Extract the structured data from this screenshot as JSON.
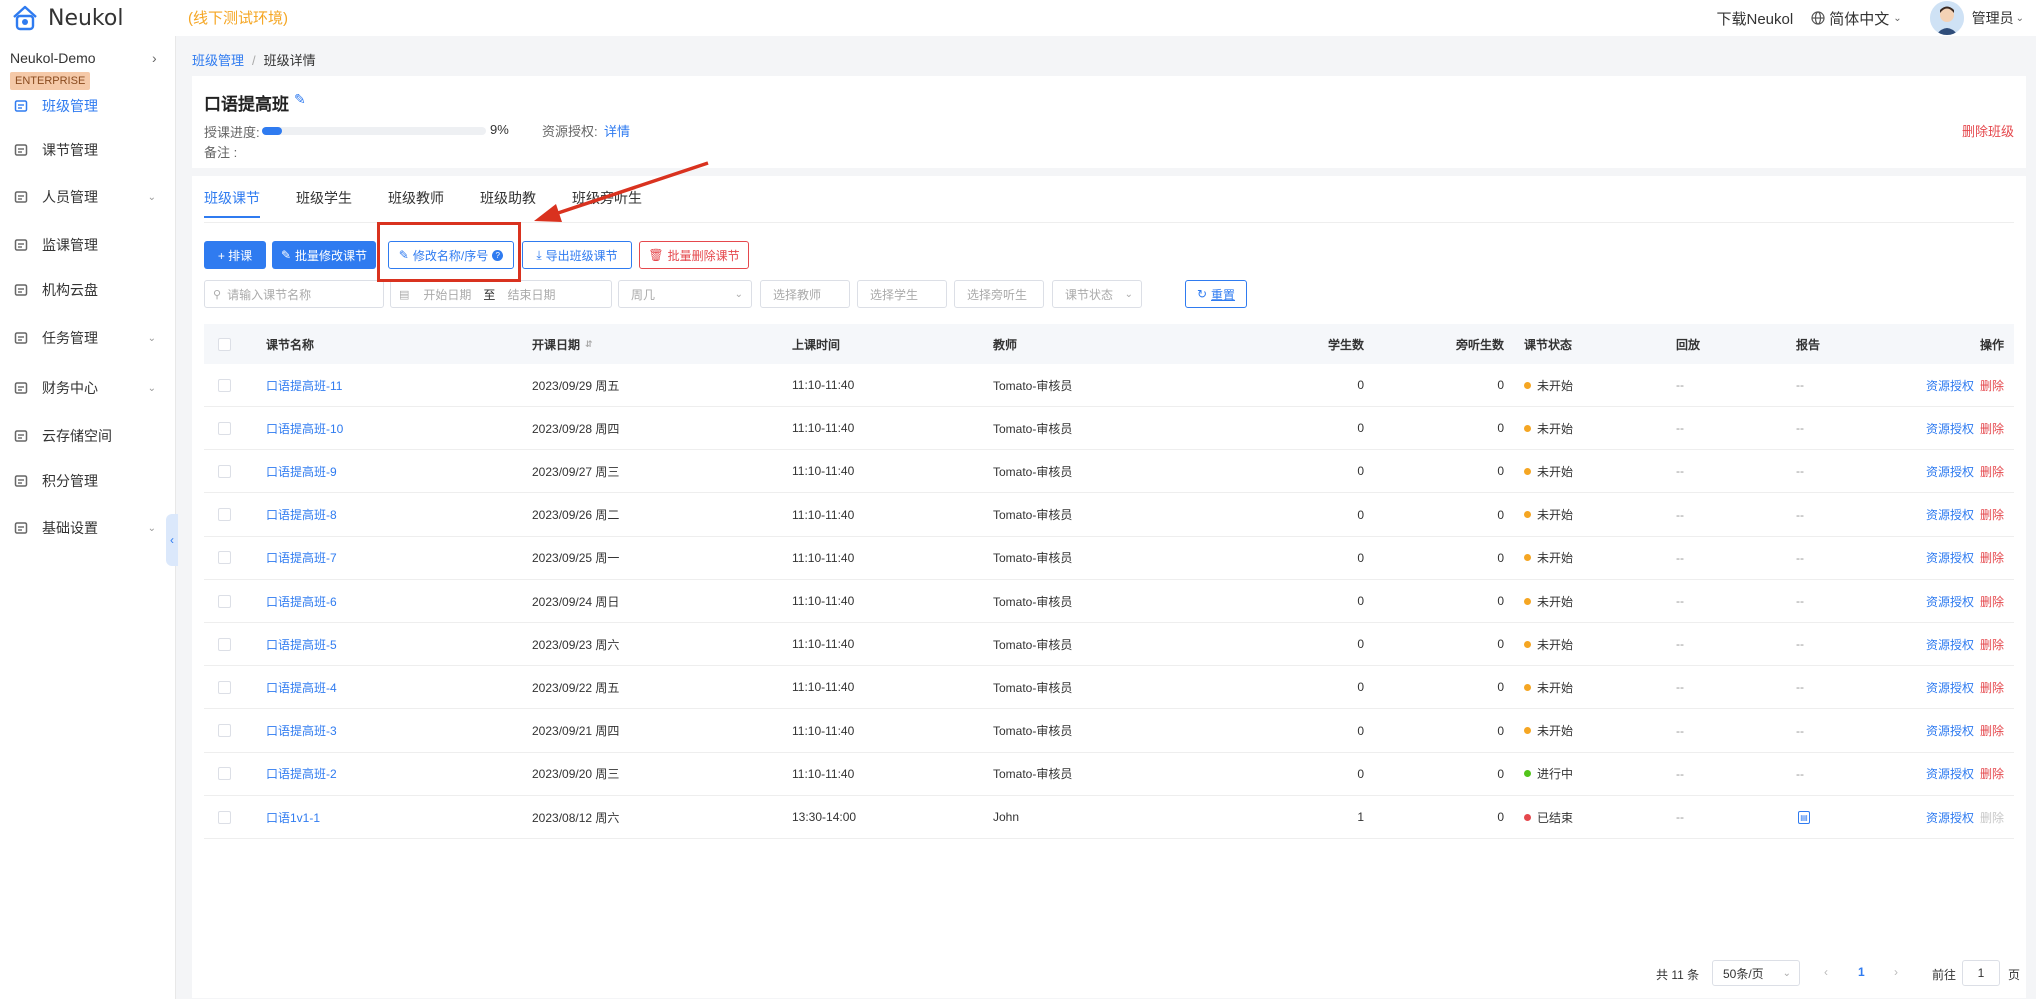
{
  "topbar": {
    "brand": "Neukol",
    "env_label": "(线下测试环境)",
    "download_label": "下载Neukol",
    "language": "简体中文",
    "user_label": "管理员"
  },
  "sidebar": {
    "org_name": "Neukol-Demo",
    "edition_badge": "ENTERPRISE",
    "items": [
      {
        "label": "班级管理",
        "icon": "class-icon",
        "active": true,
        "expandable": false
      },
      {
        "label": "课节管理",
        "icon": "lesson-icon",
        "active": false,
        "expandable": false
      },
      {
        "label": "人员管理",
        "icon": "people-icon",
        "active": false,
        "expandable": true
      },
      {
        "label": "监课管理",
        "icon": "monitor-icon",
        "active": false,
        "expandable": false
      },
      {
        "label": "机构云盘",
        "icon": "cloud-icon",
        "active": false,
        "expandable": false
      },
      {
        "label": "任务管理",
        "icon": "task-icon",
        "active": false,
        "expandable": true
      },
      {
        "label": "财务中心",
        "icon": "finance-icon",
        "active": false,
        "expandable": true
      },
      {
        "label": "云存储空间",
        "icon": "storage-icon",
        "active": false,
        "expandable": false
      },
      {
        "label": "积分管理",
        "icon": "points-icon",
        "active": false,
        "expandable": false
      },
      {
        "label": "基础设置",
        "icon": "settings-icon",
        "active": false,
        "expandable": true
      }
    ]
  },
  "breadcrumb": {
    "parent": "班级管理",
    "current": "班级详情"
  },
  "class_info": {
    "title": "口语提高班",
    "progress_label": "授课进度:",
    "progress_percent": 9,
    "progress_text": "9%",
    "resource_label": "资源授权:",
    "resource_link": "详情",
    "remark_label": "备注 :",
    "delete_label": "删除班级"
  },
  "tabs": [
    "班级课节",
    "班级学生",
    "班级教师",
    "班级助教",
    "班级旁听生"
  ],
  "toolbar": {
    "schedule": "+ 排课",
    "batch_edit": "批量修改课节",
    "rename": "修改名称/序号",
    "export": "导出班级课节",
    "batch_delete": "批量删除课节"
  },
  "filters": {
    "lesson_name": "请输入课节名称",
    "start_date": "开始日期",
    "date_sep": "至",
    "end_date": "结束日期",
    "weekday": "周几",
    "teacher": "选择教师",
    "student": "选择学生",
    "auditor": "选择旁听生",
    "status": "课节状态",
    "reset": "重置"
  },
  "table": {
    "columns": [
      "课节名称",
      "开课日期",
      "上课时间",
      "教师",
      "学生数",
      "旁听生数",
      "课节状态",
      "回放",
      "报告",
      "操作"
    ],
    "op_auth": "资源授权",
    "op_delete": "删除",
    "rows": [
      {
        "name": "口语提高班-11",
        "date": "2023/09/29 周五",
        "time": "11:10-11:40",
        "teacher": "Tomato-审核员",
        "students": "0",
        "auditors": "0",
        "status": "未开始",
        "status_color": "#f5a623",
        "replay": "--",
        "report": "--",
        "delete_disabled": false
      },
      {
        "name": "口语提高班-10",
        "date": "2023/09/28 周四",
        "time": "11:10-11:40",
        "teacher": "Tomato-审核员",
        "students": "0",
        "auditors": "0",
        "status": "未开始",
        "status_color": "#f5a623",
        "replay": "--",
        "report": "--",
        "delete_disabled": false
      },
      {
        "name": "口语提高班-9",
        "date": "2023/09/27 周三",
        "time": "11:10-11:40",
        "teacher": "Tomato-审核员",
        "students": "0",
        "auditors": "0",
        "status": "未开始",
        "status_color": "#f5a623",
        "replay": "--",
        "report": "--",
        "delete_disabled": false
      },
      {
        "name": "口语提高班-8",
        "date": "2023/09/26 周二",
        "time": "11:10-11:40",
        "teacher": "Tomato-审核员",
        "students": "0",
        "auditors": "0",
        "status": "未开始",
        "status_color": "#f5a623",
        "replay": "--",
        "report": "--",
        "delete_disabled": false
      },
      {
        "name": "口语提高班-7",
        "date": "2023/09/25 周一",
        "time": "11:10-11:40",
        "teacher": "Tomato-审核员",
        "students": "0",
        "auditors": "0",
        "status": "未开始",
        "status_color": "#f5a623",
        "replay": "--",
        "report": "--",
        "delete_disabled": false
      },
      {
        "name": "口语提高班-6",
        "date": "2023/09/24 周日",
        "time": "11:10-11:40",
        "teacher": "Tomato-审核员",
        "students": "0",
        "auditors": "0",
        "status": "未开始",
        "status_color": "#f5a623",
        "replay": "--",
        "report": "--",
        "delete_disabled": false
      },
      {
        "name": "口语提高班-5",
        "date": "2023/09/23 周六",
        "time": "11:10-11:40",
        "teacher": "Tomato-审核员",
        "students": "0",
        "auditors": "0",
        "status": "未开始",
        "status_color": "#f5a623",
        "replay": "--",
        "report": "--",
        "delete_disabled": false
      },
      {
        "name": "口语提高班-4",
        "date": "2023/09/22 周五",
        "time": "11:10-11:40",
        "teacher": "Tomato-审核员",
        "students": "0",
        "auditors": "0",
        "status": "未开始",
        "status_color": "#f5a623",
        "replay": "--",
        "report": "--",
        "delete_disabled": false
      },
      {
        "name": "口语提高班-3",
        "date": "2023/09/21 周四",
        "time": "11:10-11:40",
        "teacher": "Tomato-审核员",
        "students": "0",
        "auditors": "0",
        "status": "未开始",
        "status_color": "#f5a623",
        "replay": "--",
        "report": "--",
        "delete_disabled": false
      },
      {
        "name": "口语提高班-2",
        "date": "2023/09/20 周三",
        "time": "11:10-11:40",
        "teacher": "Tomato-审核员",
        "students": "0",
        "auditors": "0",
        "status": "进行中",
        "status_color": "#52c41a",
        "replay": "--",
        "report": "--",
        "delete_disabled": false
      },
      {
        "name": "口语1v1-1",
        "date": "2023/08/12 周六",
        "time": "13:30-14:00",
        "teacher": "John",
        "students": "1",
        "auditors": "0",
        "status": "已结束",
        "status_color": "#e5484d",
        "replay": "--",
        "report": "report-icon",
        "delete_disabled": true
      }
    ]
  },
  "pagination": {
    "total": "共 11 条",
    "page_size": "50条/页",
    "current_page": "1",
    "goto_label": "前往",
    "goto_value": "1",
    "page_unit": "页"
  },
  "colors": {
    "primary": "#2f7bf0",
    "danger": "#e5484d",
    "warning": "#f5a623",
    "success": "#52c41a",
    "annotation": "#d9321f"
  }
}
